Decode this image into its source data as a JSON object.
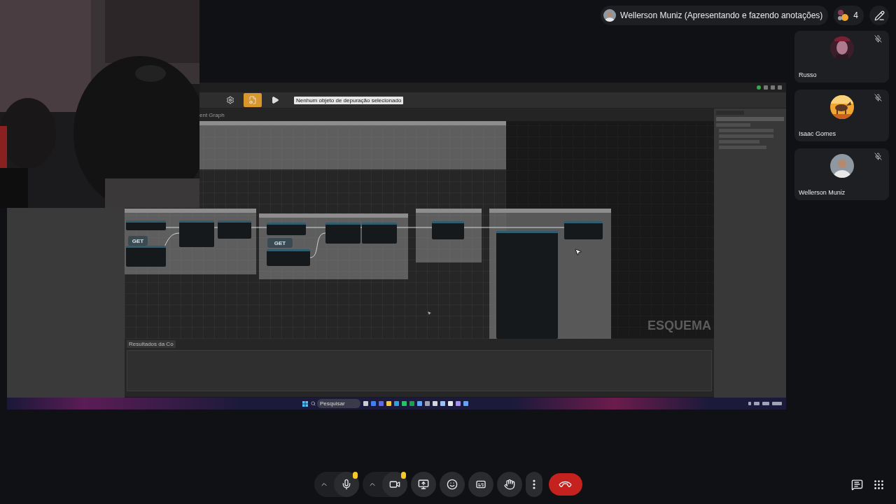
{
  "presenter": {
    "name": "Wellerson Muniz (Apresentando e fazendo anotações)"
  },
  "participant_count": "4",
  "shared_screen": {
    "toolbar_buttons": [
      {
        "kind": "settings",
        "selected": false
      },
      {
        "kind": "defaults",
        "selected": true
      },
      {
        "kind": "play",
        "selected": false
      }
    ],
    "debug_dropdown": "Nenhum objeto de depuração selecionado",
    "graph_tab": "ent Graph",
    "get_nodes": [
      "GET",
      "GET"
    ],
    "graph_label": "ESQUEMA",
    "results_tab": "Resultados da Co",
    "taskbar_search": {
      "placeholder": "Pesquisar"
    }
  },
  "participants": [
    {
      "name": "Russo",
      "muted": true
    },
    {
      "name": "Isaac Gomes",
      "muted": true
    },
    {
      "name": "Wellerson Muniz",
      "muted": true
    }
  ],
  "controls": {
    "mic": {
      "on": true,
      "warning": true
    },
    "camera": {
      "on": true,
      "warning": true
    }
  }
}
